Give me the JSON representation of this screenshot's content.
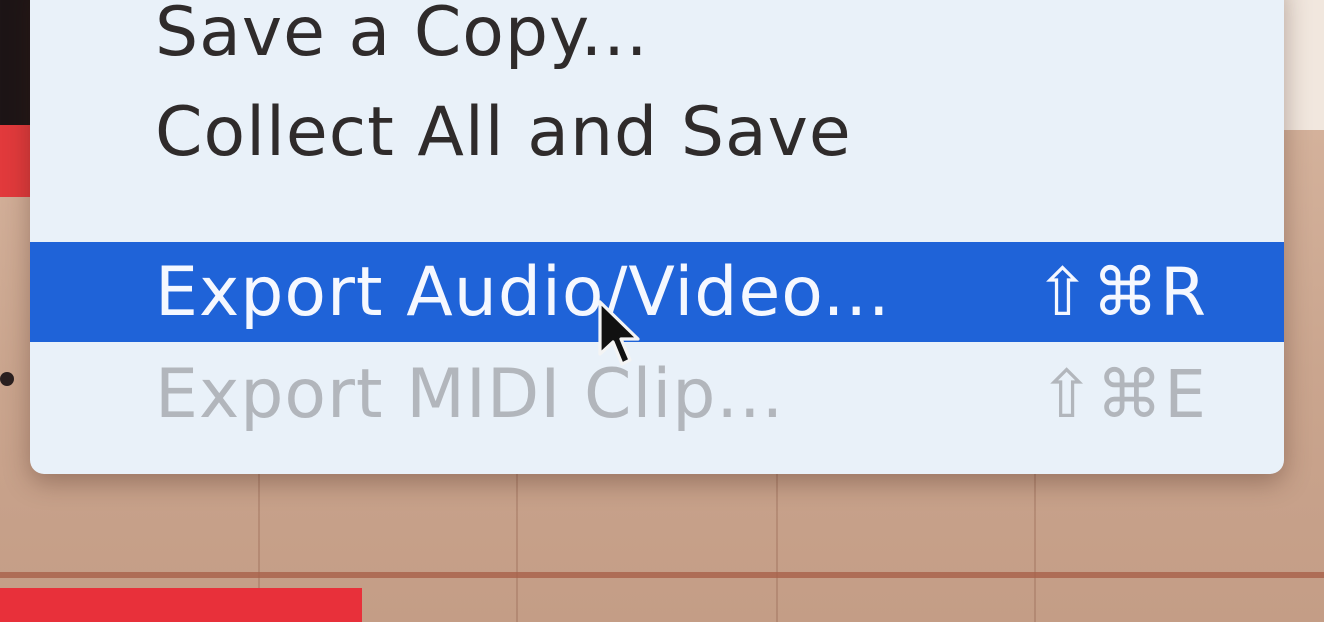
{
  "menu": {
    "items": [
      {
        "label": "Save a Copy...",
        "shortcut": "",
        "state": "normal"
      },
      {
        "label": "Collect All and Save",
        "shortcut": "",
        "state": "normal"
      },
      {
        "label": "Export Audio/Video...",
        "shortcut": "⇧⌘R",
        "state": "highlighted"
      },
      {
        "label": "Export MIDI Clip...",
        "shortcut": "⇧⌘E",
        "state": "disabled"
      }
    ]
  },
  "colors": {
    "highlight": "#1f63d8",
    "menu_background": "#e9f1f9",
    "disabled_text": "#b2b6bc",
    "clip_red": "#e8303a"
  },
  "icons": {
    "cursor": "arrow-pointer-icon"
  }
}
